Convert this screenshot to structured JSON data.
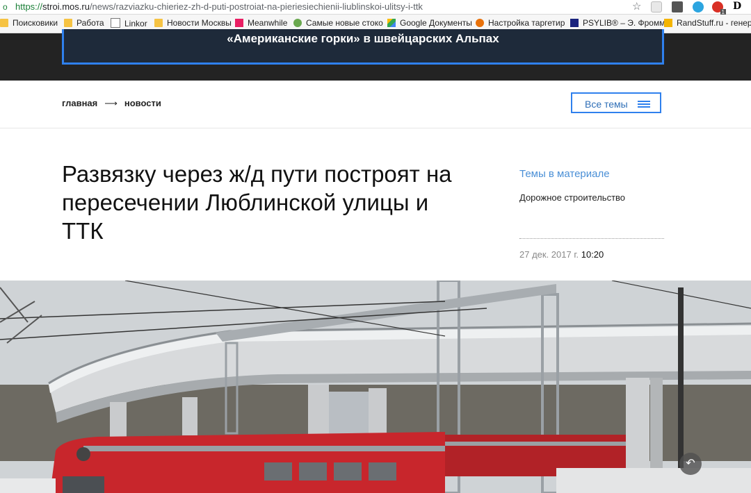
{
  "browser": {
    "url_scheme": "https://",
    "url_host": "stroi.mos.ru",
    "url_path": "/news/razviazku-chieriez-zh-d-puti-postroiat-na-pieriesiechienii-liublinskoi-ulitsy-i-ttk",
    "extension_badge": "1"
  },
  "bookmarks": [
    {
      "label": "Поисковики",
      "icon": "folder"
    },
    {
      "label": "Работа",
      "icon": "folder"
    },
    {
      "label": "Linkor",
      "icon": "page"
    },
    {
      "label": "Новости Москвы",
      "icon": "folder"
    },
    {
      "label": "Meanwhile",
      "icon": "pink"
    },
    {
      "label": "Самые новые стоко",
      "icon": "green"
    },
    {
      "label": "Google Документы",
      "icon": "drive"
    },
    {
      "label": "Настройка таргетир",
      "icon": "orange"
    },
    {
      "label": "PSYLIB® – Э. Фромм",
      "icon": "ps"
    },
    {
      "label": "RandStuff.ru - генера",
      "icon": "rs"
    }
  ],
  "banner": {
    "title": "«Американские горки» в швейцарских Альпах"
  },
  "breadcrumb": {
    "home": "главная",
    "arrow": "⟶",
    "section": "новости"
  },
  "topics_button": {
    "label": "Все темы"
  },
  "article": {
    "headline_lines": [
      "Развязку через ж/д пути построят на",
      "пересечении Люблинской улицы и",
      "ТТК"
    ],
    "topics_title": "Темы в материале",
    "topic": "Дорожное строительство",
    "date": "27 дек. 2017 г.",
    "time": "10:20"
  },
  "colors": {
    "accent": "#2f80ed",
    "banner_bg": "#232323",
    "train_red": "#c8262c"
  }
}
